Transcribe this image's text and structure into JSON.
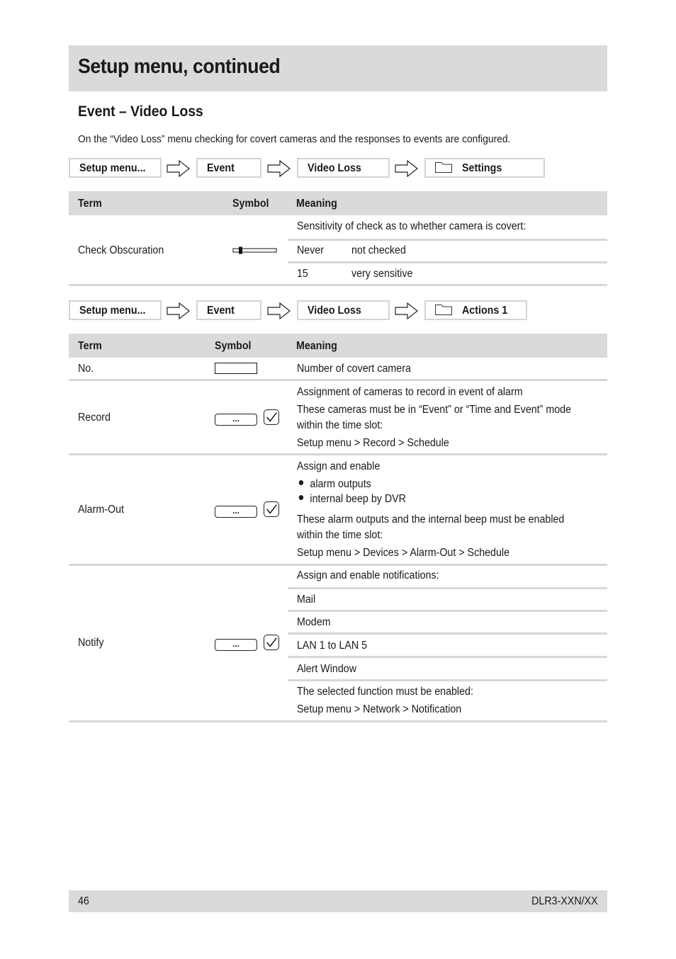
{
  "header": {
    "title": "Setup menu, continued"
  },
  "section": {
    "title": "Event – Video Loss",
    "intro": "On the “Video Loss” menu checking for covert cameras and the responses to events are configured."
  },
  "breadcrumb1": {
    "items": [
      "Setup menu...",
      "Event",
      "Video Loss",
      "Settings"
    ],
    "icons": [
      "arrow-right-icon",
      "folder-icon"
    ]
  },
  "table1": {
    "headers": {
      "term": "Term",
      "symbol": "Symbol",
      "meaning": "Meaning"
    },
    "rows": [
      {
        "term": "Check Obscuration",
        "symbol": "slider",
        "meaning_intro": "Sensitivity of check as to whether camera is covert:",
        "options": [
          {
            "value": "Never",
            "desc": "not checked"
          },
          {
            "value": "15",
            "desc": "very sensitive"
          }
        ]
      }
    ]
  },
  "breadcrumb2": {
    "items": [
      "Setup menu...",
      "Event",
      "Video Loss",
      "Actions 1"
    ]
  },
  "table2": {
    "headers": {
      "term": "Term",
      "symbol": "Symbol",
      "meaning": "Meaning"
    },
    "rows": [
      {
        "term": "No.",
        "symbol": "input-field",
        "meaning": [
          "Number of covert camera"
        ]
      },
      {
        "term": "Record",
        "symbol": "ellipsis-button-checkbox",
        "button_label": "...",
        "meaning": [
          "Assignment of cameras to record in event of alarm",
          "These cameras must be in “Event” or “Time and Event” mode",
          "within the time slot:",
          "Setup menu > Record > Schedule"
        ]
      },
      {
        "term": "Alarm-Out",
        "symbol": "ellipsis-button-checkbox",
        "button_label": "...",
        "meaning_intro": "Assign and enable",
        "bullets": [
          "alarm outputs",
          "internal beep by DVR"
        ],
        "meaning": [
          "These alarm outputs and the internal beep must be enabled",
          "within the time slot:",
          "Setup menu > Devices > Alarm-Out > Schedule"
        ]
      },
      {
        "term": "Notify",
        "symbol": "ellipsis-button-checkbox",
        "button_label": "...",
        "meaning_intro": "Assign and enable notifications:",
        "options": [
          "Mail",
          "Modem",
          "LAN 1 to LAN 5",
          "Alert Window"
        ],
        "meaning": [
          "The selected function must be enabled:",
          "Setup menu > Network > Notification"
        ]
      }
    ]
  },
  "footer": {
    "page_number": "46",
    "model": "DLR3-XXN/XX"
  }
}
